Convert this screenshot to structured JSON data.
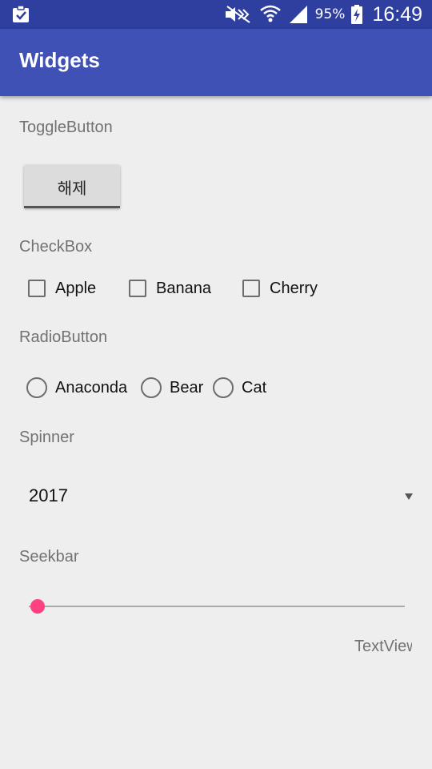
{
  "status_bar": {
    "battery_percent": "95%",
    "time": "16:49",
    "icons": [
      "clipboard-check-icon",
      "mute-icon",
      "wifi-icon",
      "signal-icon",
      "battery-charging-icon"
    ]
  },
  "app_bar": {
    "title": "Widgets"
  },
  "toggle_section": {
    "label": "ToggleButton",
    "button_text": "해제"
  },
  "checkbox_section": {
    "label": "CheckBox",
    "items": [
      {
        "label": "Apple",
        "checked": false
      },
      {
        "label": "Banana",
        "checked": false
      },
      {
        "label": "Cherry",
        "checked": false
      }
    ]
  },
  "radio_section": {
    "label": "RadioButton",
    "items": [
      {
        "label": "Anaconda",
        "selected": false
      },
      {
        "label": "Bear",
        "selected": false
      },
      {
        "label": "Cat",
        "selected": false
      }
    ]
  },
  "spinner_section": {
    "label": "Spinner",
    "selected_value": "2017"
  },
  "seekbar_section": {
    "label": "Seekbar",
    "progress": 0
  },
  "textview": {
    "text": "TextView"
  },
  "colors": {
    "status_bar": "#2f3f9f",
    "app_bar": "#3f51b5",
    "accent": "#ff4081",
    "background": "#eeeeee"
  }
}
